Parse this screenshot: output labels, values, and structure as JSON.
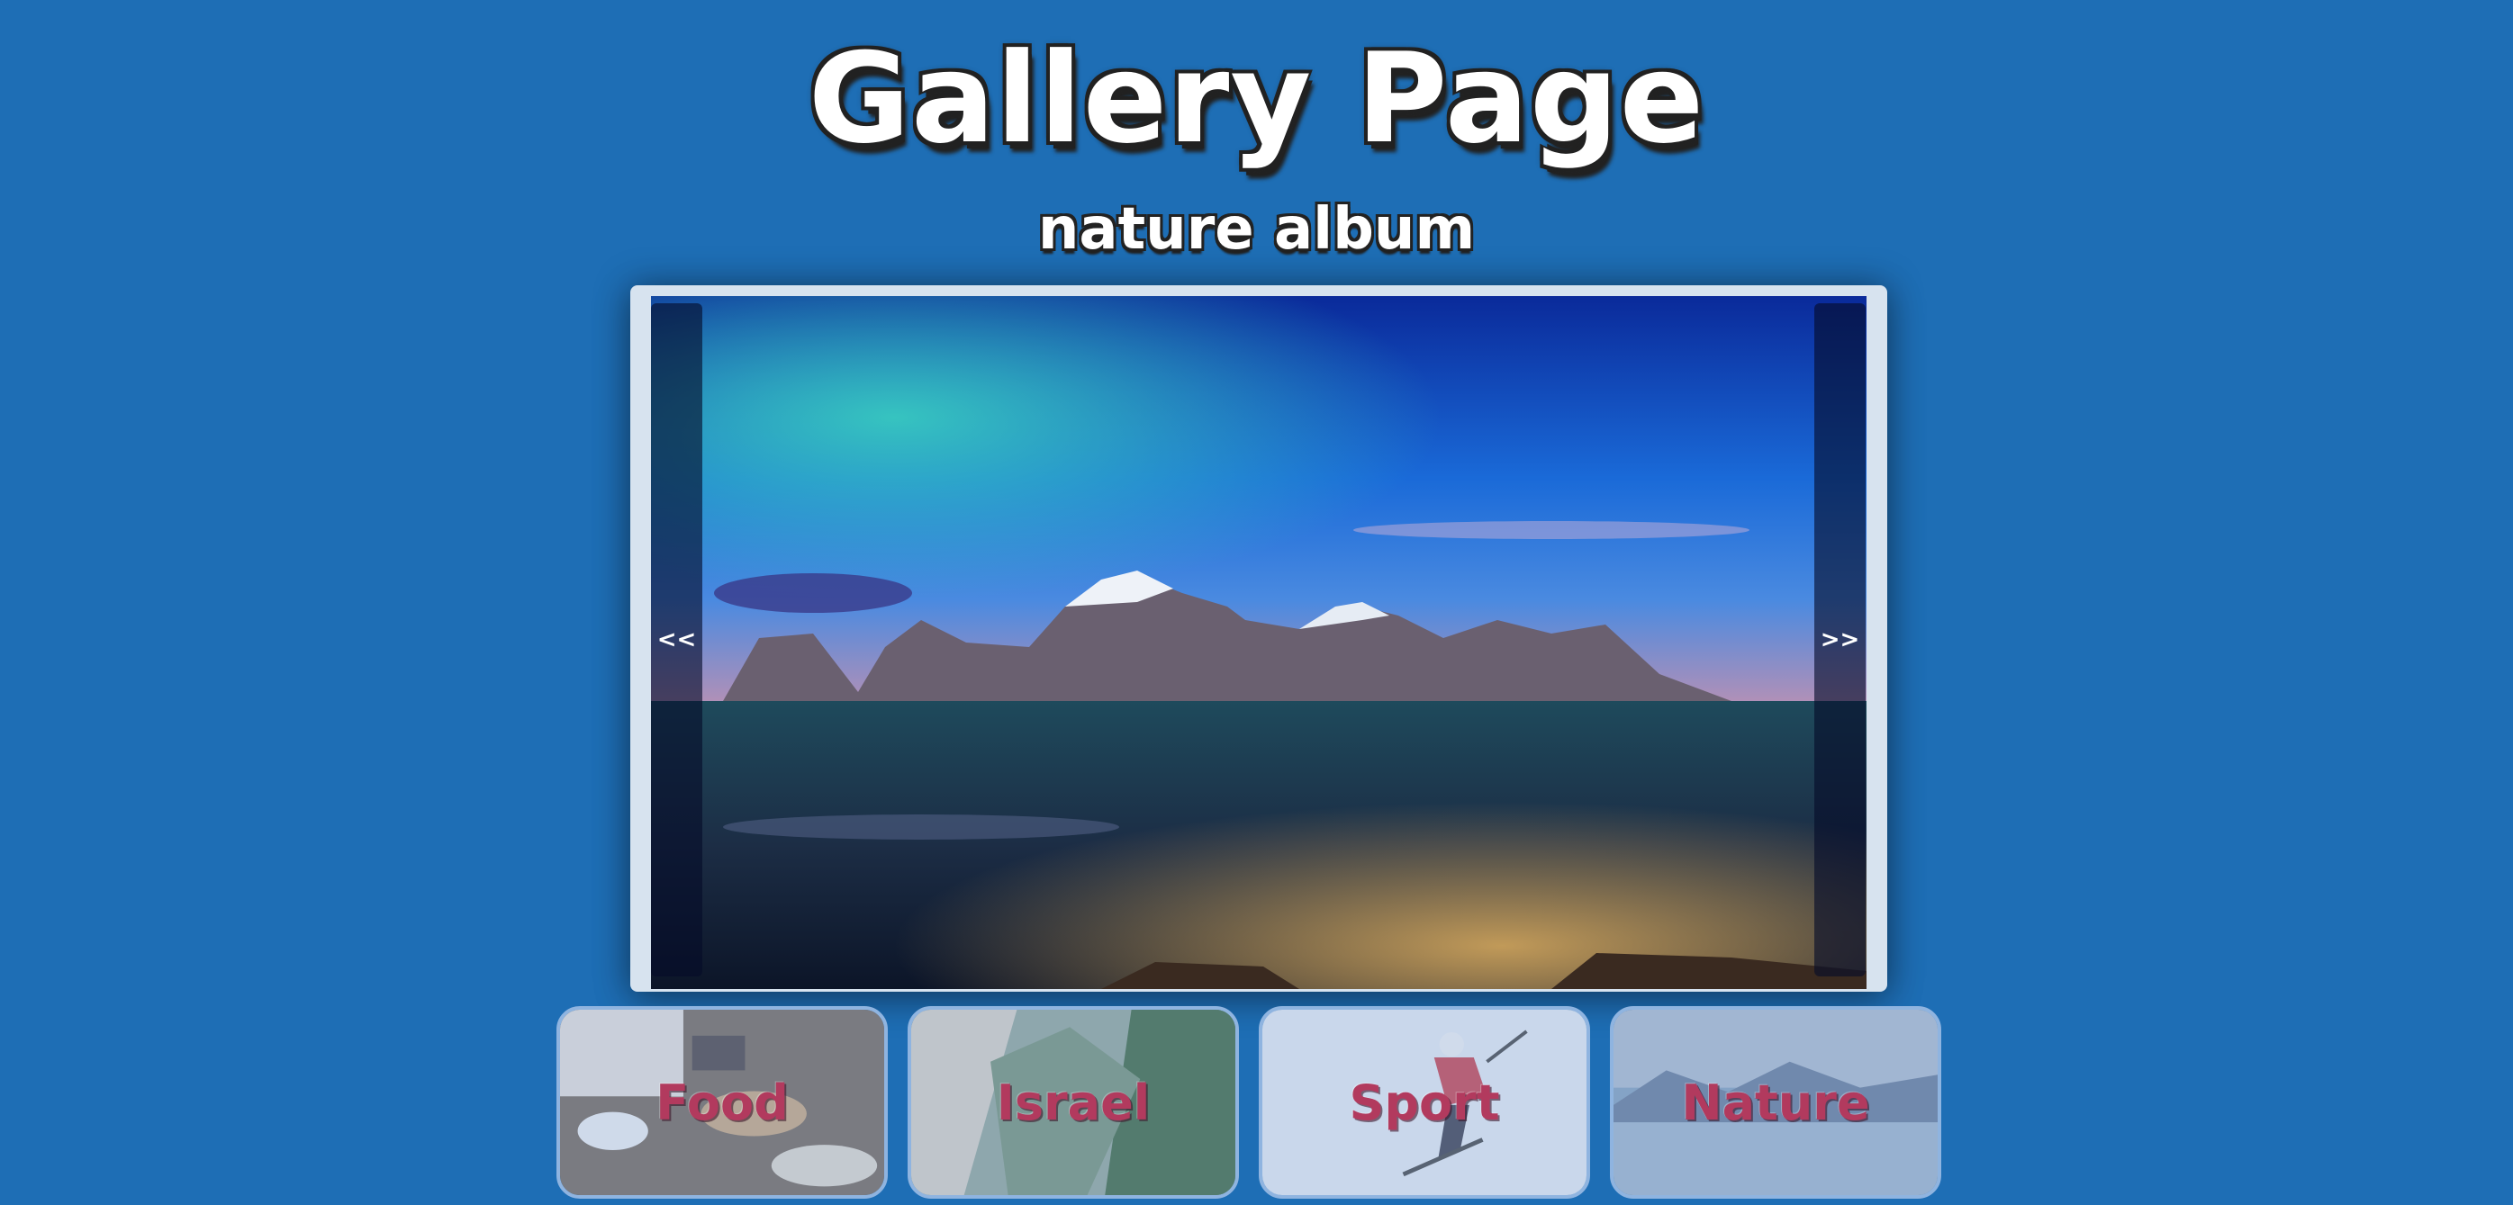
{
  "header": {
    "title": "Gallery Page",
    "subtitle": "nature album"
  },
  "viewer": {
    "prev_label": "<<",
    "next_label": ">>"
  },
  "albums": [
    {
      "label": "Food"
    },
    {
      "label": "Israel"
    },
    {
      "label": "Sport"
    },
    {
      "label": "Nature"
    }
  ],
  "colors": {
    "background": "#1e6eb5",
    "album_label": "#b23a5e",
    "album_border": "#8fb4e0"
  }
}
